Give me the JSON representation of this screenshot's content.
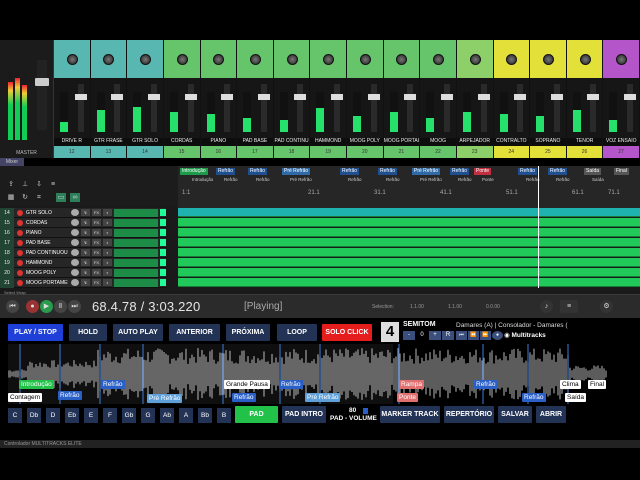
{
  "colors": {
    "accent_green": "#25e06a",
    "play_blue": "#1f3fd9",
    "solo_red": "#e51d1d",
    "pad_green": "#22c24a",
    "button_navy": "#233356"
  },
  "mixer": {
    "master_label": "MASTER",
    "routing_tag": "Mixer",
    "channels": [
      {
        "name": "DRIVE R",
        "num": "12",
        "color": "#58b7b1"
      },
      {
        "name": "GTR FRASE",
        "num": "13",
        "color": "#58b7b1"
      },
      {
        "name": "GTR SOLO",
        "num": "14",
        "color": "#58b7b1"
      },
      {
        "name": "CORDAS",
        "num": "15",
        "color": "#66c46a"
      },
      {
        "name": "PIANO",
        "num": "16",
        "color": "#66c46a"
      },
      {
        "name": "PAD BASE",
        "num": "17",
        "color": "#66c46a"
      },
      {
        "name": "PAD CONTINU",
        "num": "18",
        "color": "#66c46a"
      },
      {
        "name": "HAMMOND",
        "num": "19",
        "color": "#66c46a"
      },
      {
        "name": "MOOG POLY",
        "num": "20",
        "color": "#66c46a"
      },
      {
        "name": "MOOG PORTAI",
        "num": "21",
        "color": "#66c46a"
      },
      {
        "name": "MOOG",
        "num": "22",
        "color": "#66c46a"
      },
      {
        "name": "ARPEJADOR",
        "num": "23",
        "color": "#8dd06a"
      },
      {
        "name": "CONTRALTO",
        "num": "24",
        "color": "#e4e03a"
      },
      {
        "name": "SOPRANO",
        "num": "25",
        "color": "#e4e03a"
      },
      {
        "name": "TENOR",
        "num": "26",
        "color": "#e4e03a"
      },
      {
        "name": "VOZ ENSAIO",
        "num": "27",
        "color": "#b455c9"
      }
    ]
  },
  "timeline": {
    "markers_top": [
      "Introdução",
      "Refrão",
      "Refrão",
      "Pré Refrão",
      "Refrão",
      "Refrão",
      "Pré Refrão",
      "Refrão",
      "Ponte",
      "Refrão",
      "Refrão",
      "Saída",
      "Final"
    ],
    "markers_sub": [
      "Introdução",
      "Refrão",
      "Refrão",
      "Pré Refrão",
      "Refrão",
      "Refrão",
      "Pré Refrão",
      "Refrão",
      "Ponte",
      "Refrão",
      "Refrão",
      "Saída"
    ],
    "bar_numbers": [
      "1:1",
      "21.1",
      "31.1",
      "41.1",
      "51.1",
      "61.1",
      "71.1"
    ]
  },
  "tracks": [
    {
      "num": "14",
      "name": "GTR SOLO"
    },
    {
      "num": "15",
      "name": "CORDAS"
    },
    {
      "num": "16",
      "name": "PIANO"
    },
    {
      "num": "17",
      "name": "PAD BASE"
    },
    {
      "num": "18",
      "name": "PAD CONTINUOUS"
    },
    {
      "num": "19",
      "name": "HAMMOND"
    },
    {
      "num": "20",
      "name": "MOOG POLY"
    },
    {
      "num": "21",
      "name": "MOOG PORTAMEN"
    }
  ],
  "transport": {
    "timecode": "68.4.78 / 3:03.220",
    "state": "[Playing]",
    "selection_label": "Selection:",
    "sel_start": "1.1.00",
    "sel_end": "1.1.00",
    "sel_len": "0.0.00",
    "left_hint": "Select Wrap"
  },
  "controller": {
    "buttons": {
      "play_stop": "PLAY / STOP",
      "hold": "HOLD",
      "auto_play": "AUTO PLAY",
      "anterior": "ANTERIOR",
      "proxima": "PRÓXIMA",
      "loop": "LOOP",
      "solo_click": "SOLO CLICK",
      "pad": "PAD",
      "pad_intro": "PAD INTRO",
      "pad_volume_value": "80",
      "pad_volume_label": "PAD - VOLUME",
      "marker_track": "MARKER TRACK",
      "repertorio": "REPERTÓRIO",
      "salvar": "SALVAR",
      "abrir": "ABRIR"
    },
    "semitone": {
      "value": "4",
      "label": "SEMITOM",
      "minus": "-",
      "amount": "0",
      "plus": "+",
      "reset": "R"
    },
    "song_info": "Damares (A)  |  Consolador - Damares (",
    "brand": "Multitracks",
    "wave_markers": [
      {
        "label": "Contagem",
        "style": "w"
      },
      {
        "label": "Refrão",
        "style": "b"
      },
      {
        "label": "Introdução",
        "style": "g"
      },
      {
        "label": "Refrão",
        "style": "b"
      },
      {
        "label": "Pré Refrão",
        "style": "c"
      },
      {
        "label": "Refrão",
        "style": "b"
      },
      {
        "label": "Grande Pausa",
        "style": "w"
      },
      {
        "label": "Refrão",
        "style": "b"
      },
      {
        "label": "Pré Refrão",
        "style": "c"
      },
      {
        "label": "Rampa",
        "style": "r"
      },
      {
        "label": "Ponte",
        "style": "r"
      },
      {
        "label": "Refrão",
        "style": "b"
      },
      {
        "label": "Refrão",
        "style": "b"
      },
      {
        "label": "Clima",
        "style": "w"
      },
      {
        "label": "Saída",
        "style": "w"
      },
      {
        "label": "Final",
        "style": "w"
      }
    ],
    "keys": [
      "C",
      "Db",
      "D",
      "Eb",
      "E",
      "F",
      "Gb",
      "G",
      "Ab",
      "A",
      "Bb",
      "B"
    ]
  },
  "statusbar": "Controlador MULTITRACKS ELITE"
}
